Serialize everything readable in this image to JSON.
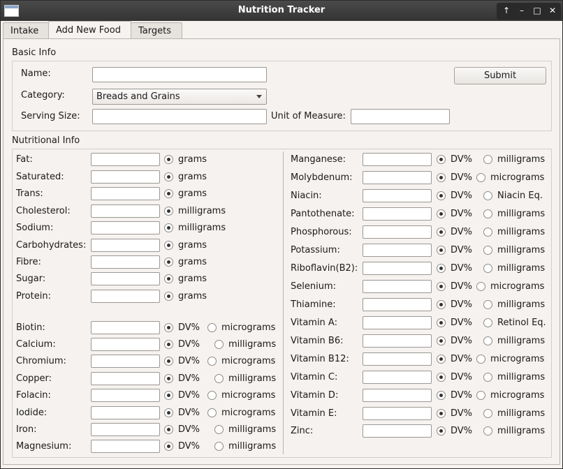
{
  "window": {
    "title": "Nutrition Tracker",
    "controls": [
      "↑",
      "–",
      "□",
      "✕"
    ]
  },
  "tabs": [
    {
      "label": "Intake",
      "active": false
    },
    {
      "label": "Add New Food",
      "active": true
    },
    {
      "label": "Targets",
      "active": false
    }
  ],
  "basic_info": {
    "title": "Basic Info",
    "name_label": "Name:",
    "name_value": "",
    "category_label": "Category:",
    "category_value": "Breads and Grains",
    "serving_label": "Serving Size:",
    "serving_value": "",
    "unit_label": "Unit of Measure:",
    "unit_value": "",
    "submit_label": "Submit"
  },
  "nutritional_info": {
    "title": "Nutritional Info",
    "left_macros": [
      {
        "label": "Fat:",
        "unit": "grams"
      },
      {
        "label": "Saturated:",
        "unit": "grams"
      },
      {
        "label": "Trans:",
        "unit": "grams"
      },
      {
        "label": "Cholesterol:",
        "unit": "milligrams"
      },
      {
        "label": "Sodium:",
        "unit": "milligrams"
      },
      {
        "label": "Carbohydrates:",
        "unit": "grams"
      },
      {
        "label": "Fibre:",
        "unit": "grams"
      },
      {
        "label": "Sugar:",
        "unit": "grams"
      },
      {
        "label": "Protein:",
        "unit": "grams"
      }
    ],
    "left_micros": [
      {
        "label": "Biotin:",
        "opt1": "DV%",
        "opt2": "micrograms"
      },
      {
        "label": "Calcium:",
        "opt1": "DV%",
        "opt2": "milligrams"
      },
      {
        "label": "Chromium:",
        "opt1": "DV%",
        "opt2": "micrograms"
      },
      {
        "label": "Copper:",
        "opt1": "DV%",
        "opt2": "milligrams"
      },
      {
        "label": "Folacin:",
        "opt1": "DV%",
        "opt2": "micrograms"
      },
      {
        "label": "Iodide:",
        "opt1": "DV%",
        "opt2": "micrograms"
      },
      {
        "label": "Iron:",
        "opt1": "DV%",
        "opt2": "milligrams"
      },
      {
        "label": "Magnesium:",
        "opt1": "DV%",
        "opt2": "milligrams"
      }
    ],
    "right_micros": [
      {
        "label": "Manganese:",
        "opt1": "DV%",
        "opt2": "milligrams"
      },
      {
        "label": "Molybdenum:",
        "opt1": "DV%",
        "opt2": "micrograms"
      },
      {
        "label": "Niacin:",
        "opt1": "DV%",
        "opt2": "Niacin Eq."
      },
      {
        "label": "Pantothenate:",
        "opt1": "DV%",
        "opt2": "milligrams"
      },
      {
        "label": "Phosphorous:",
        "opt1": "DV%",
        "opt2": "milligrams"
      },
      {
        "label": "Potassium:",
        "opt1": "DV%",
        "opt2": "milligrams"
      },
      {
        "label": "Riboflavin(B2):",
        "opt1": "DV%",
        "opt2": "milligrams"
      },
      {
        "label": "Selenium:",
        "opt1": "DV%",
        "opt2": "micrograms"
      },
      {
        "label": "Thiamine:",
        "opt1": "DV%",
        "opt2": "milligrams"
      },
      {
        "label": "Vitamin A:",
        "opt1": "DV%",
        "opt2": "Retinol Eq."
      },
      {
        "label": "Vitamin B6:",
        "opt1": "DV%",
        "opt2": "milligrams"
      },
      {
        "label": "Vitamin B12:",
        "opt1": "DV%",
        "opt2": "micrograms"
      },
      {
        "label": "Vitamin C:",
        "opt1": "DV%",
        "opt2": "milligrams"
      },
      {
        "label": "Vitamin D:",
        "opt1": "DV%",
        "opt2": "micrograms"
      },
      {
        "label": "Vitamin E:",
        "opt1": "DV%",
        "opt2": "milligrams"
      },
      {
        "label": "Zinc:",
        "opt1": "DV%",
        "opt2": "milligrams"
      }
    ]
  }
}
